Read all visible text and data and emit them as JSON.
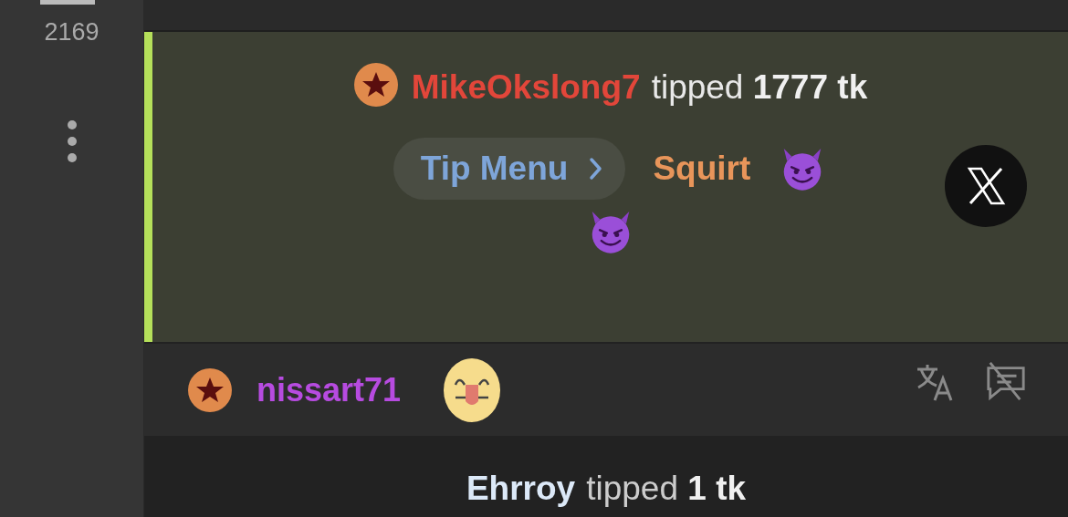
{
  "sidebar": {
    "count": "2169"
  },
  "messages": [
    {
      "kind": "tip_highlight",
      "username": "MikeOkslong7",
      "color": "#e2463a",
      "text": "tipped **1777 tk**",
      "menu_button": "Tip Menu",
      "item": "Squirt"
    },
    {
      "kind": "chat",
      "username": "nissart71",
      "color": "#b74be0"
    },
    {
      "kind": "tip_notice",
      "username": "Ehrroy",
      "color": "#dce9f8",
      "text": "tipped **1 tk**"
    }
  ]
}
